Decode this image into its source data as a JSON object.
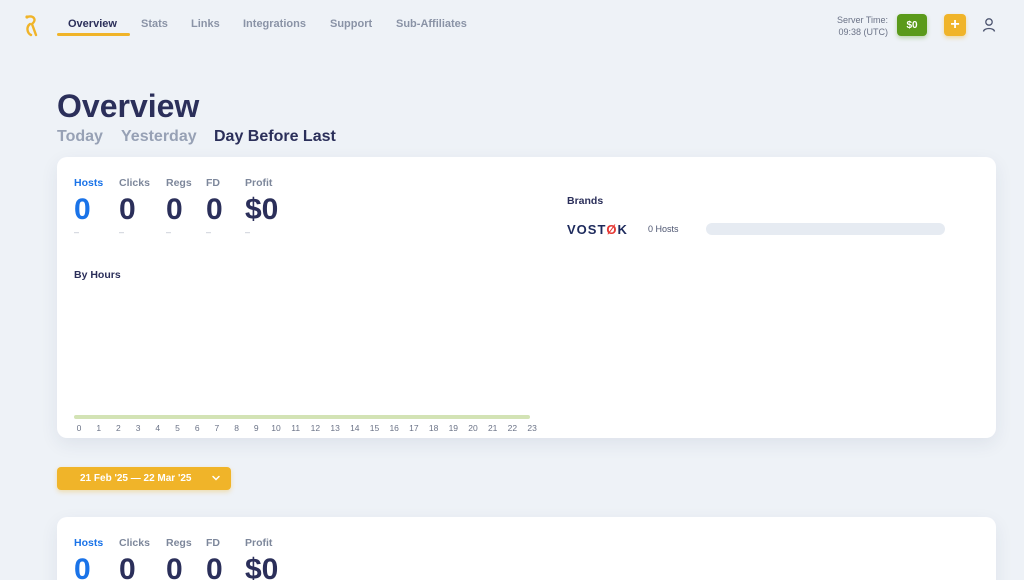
{
  "nav": {
    "items": [
      {
        "label": "Overview",
        "active": true
      },
      {
        "label": "Stats"
      },
      {
        "label": "Links"
      },
      {
        "label": "Integrations"
      },
      {
        "label": "Support"
      },
      {
        "label": "Sub-Affiliates"
      }
    ],
    "server_time_label": "Server Time:",
    "server_time_value": "09:38 (UTC)",
    "balance": "$0",
    "plus": "+"
  },
  "page": {
    "title": "Overview",
    "day_tabs": [
      {
        "label": "Today"
      },
      {
        "label": "Yesterday"
      },
      {
        "label": "Day Before Last",
        "active": true
      }
    ]
  },
  "summary": {
    "stats": [
      {
        "label": "Hosts",
        "value": "0",
        "sub": "–",
        "active": true
      },
      {
        "label": "Clicks",
        "value": "0",
        "sub": "–"
      },
      {
        "label": "Regs",
        "value": "0",
        "sub": "–"
      },
      {
        "label": "FD",
        "value": "0",
        "sub": "–"
      },
      {
        "label": "Profit",
        "value": "$0",
        "sub": "–"
      }
    ],
    "by_hours_title": "By Hours",
    "hours": [
      "0",
      "1",
      "2",
      "3",
      "4",
      "5",
      "6",
      "7",
      "8",
      "9",
      "10",
      "11",
      "12",
      "13",
      "14",
      "15",
      "16",
      "17",
      "18",
      "19",
      "20",
      "21",
      "22",
      "23"
    ],
    "brands_title": "Brands",
    "brands": [
      {
        "name_prefix": "VOST",
        "name_accent": "Ø",
        "name_suffix": "K",
        "hosts": "0 Hosts",
        "fill": 0
      }
    ]
  },
  "date_range": {
    "label": "21 Feb '25 — 22 Mar '25"
  },
  "period": {
    "stats": [
      {
        "label": "Hosts",
        "value": "0",
        "active": true
      },
      {
        "label": "Clicks",
        "value": "0"
      },
      {
        "label": "Regs",
        "value": "0"
      },
      {
        "label": "FD",
        "value": "0"
      },
      {
        "label": "Profit",
        "value": "$0"
      }
    ]
  },
  "colors": {
    "accent": "#f0b429",
    "active_blue": "#1a73e8",
    "balance_green": "#5a9a1a"
  }
}
